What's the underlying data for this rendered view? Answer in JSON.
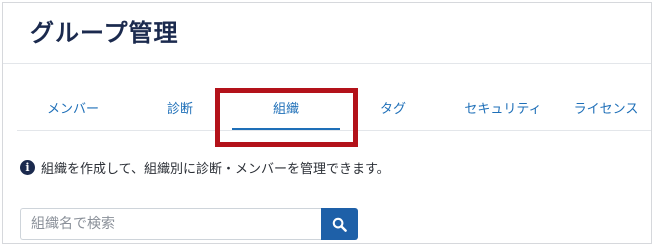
{
  "page": {
    "title": "グループ管理"
  },
  "tabs": [
    {
      "label": "メンバー",
      "active": false
    },
    {
      "label": "診断",
      "active": false
    },
    {
      "label": "組織",
      "active": true
    },
    {
      "label": "タグ",
      "active": false
    },
    {
      "label": "セキュリティ",
      "active": false
    },
    {
      "label": "ライセンス",
      "active": false
    }
  ],
  "info": {
    "icon": "info-circle-icon",
    "text": "組織を作成して、組織別に診断・メンバーを管理できます。"
  },
  "search": {
    "placeholder": "組織名で検索",
    "value": "",
    "button_icon": "search-icon"
  },
  "colors": {
    "accent": "#1e6fb8",
    "title": "#1b2a4e",
    "highlight": "#b3121a",
    "button": "#1e60a8"
  }
}
